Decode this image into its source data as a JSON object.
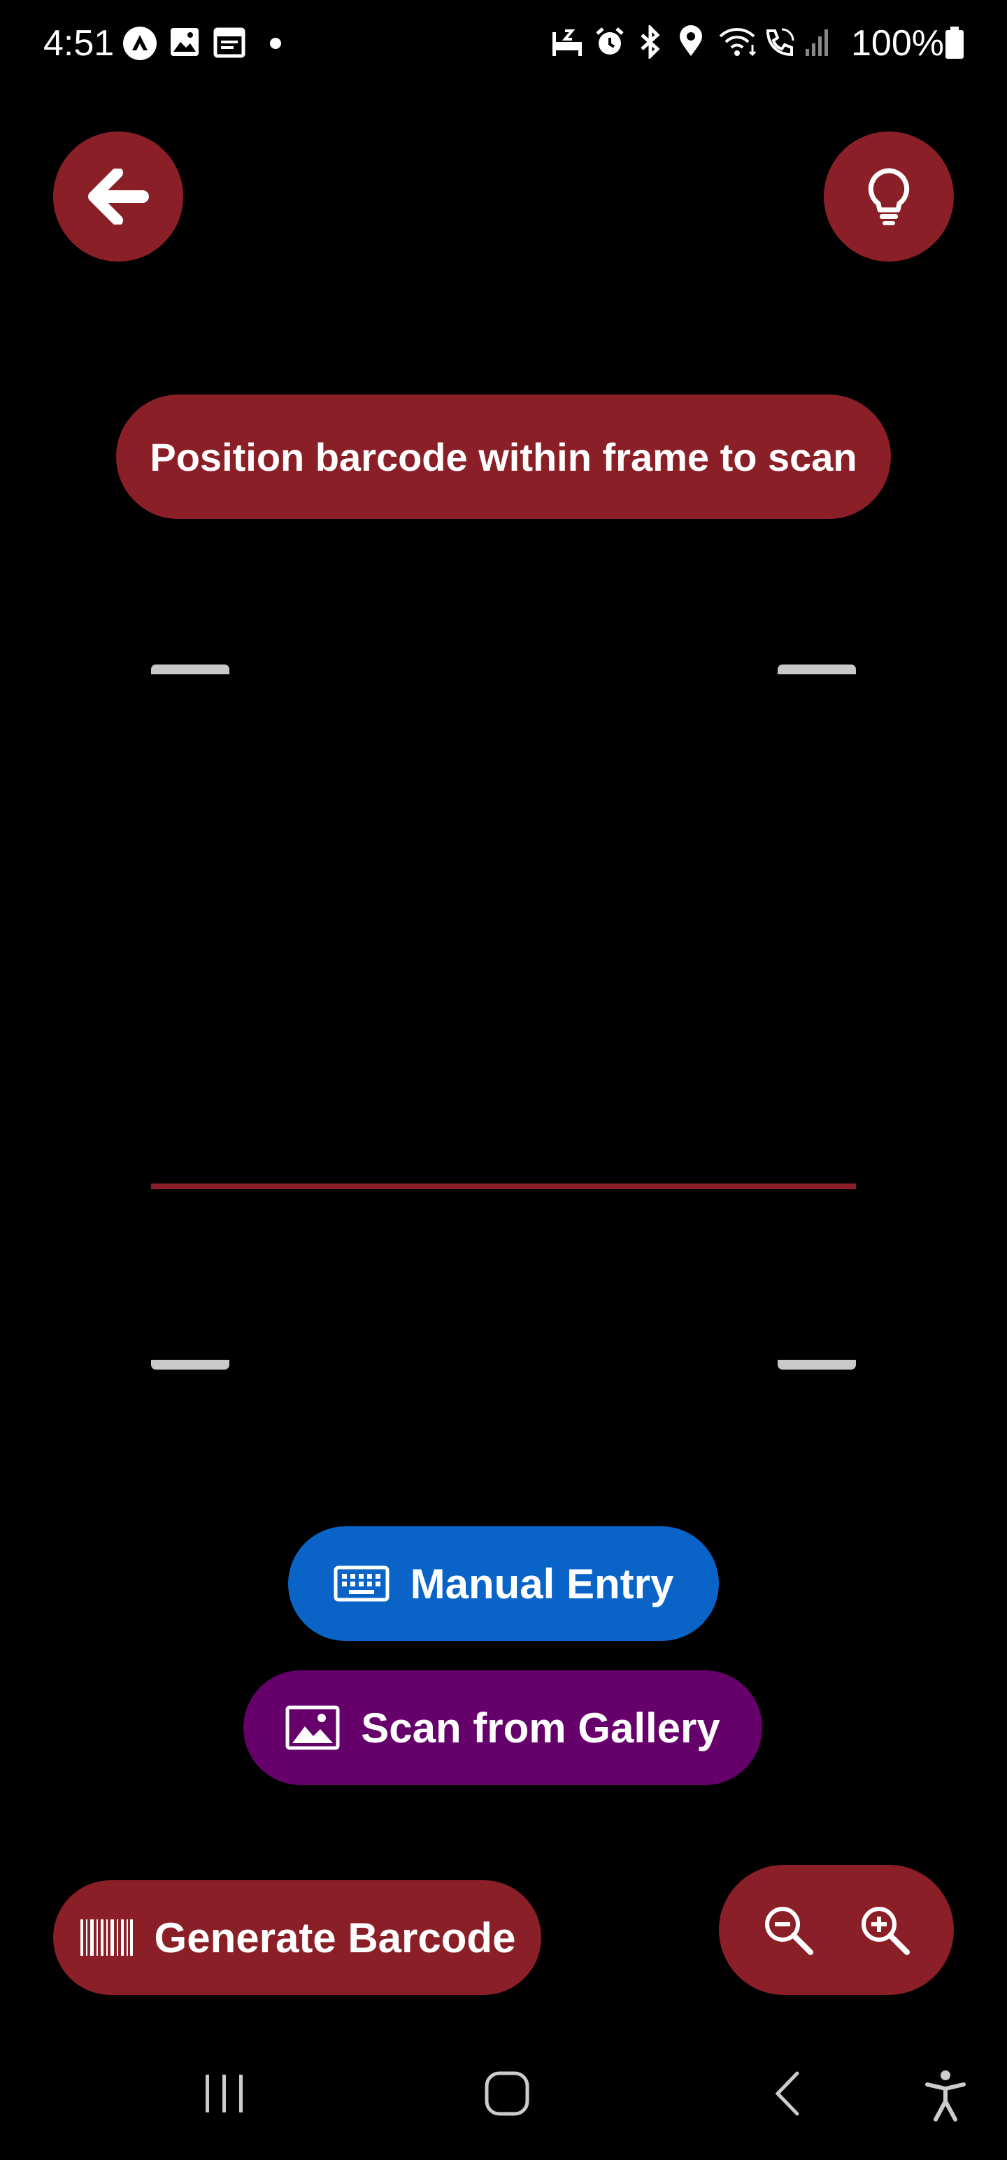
{
  "status_bar": {
    "time": "4:51",
    "battery": "100%",
    "icons": [
      "nav-app-icon",
      "gallery-icon",
      "calendar-icon",
      "dot-icon",
      "bed-icon",
      "alarm-icon",
      "bluetooth-icon",
      "location-icon",
      "wifi-icon",
      "wifi-calling-icon",
      "signal-icon",
      "battery-icon"
    ]
  },
  "top_bar": {
    "back_icon": "arrow-left-icon",
    "flash_icon": "lightbulb-icon"
  },
  "hint": {
    "text": "Position barcode within frame to scan"
  },
  "actions": {
    "manual_entry": "Manual Entry",
    "scan_gallery": "Scan from Gallery",
    "generate_barcode": "Generate Barcode"
  },
  "zoom": {
    "zoom_out_icon": "zoom-out-icon",
    "zoom_in_icon": "zoom-in-icon"
  },
  "nav_bar": {
    "icons": [
      "recents-icon",
      "home-icon",
      "back-icon",
      "accessibility-icon"
    ]
  },
  "colors": {
    "accent_red": "#8b1f27",
    "manual_blue": "#0a64c8",
    "gallery_purple": "#66006b",
    "frame_corner": "#c9c9c9"
  }
}
